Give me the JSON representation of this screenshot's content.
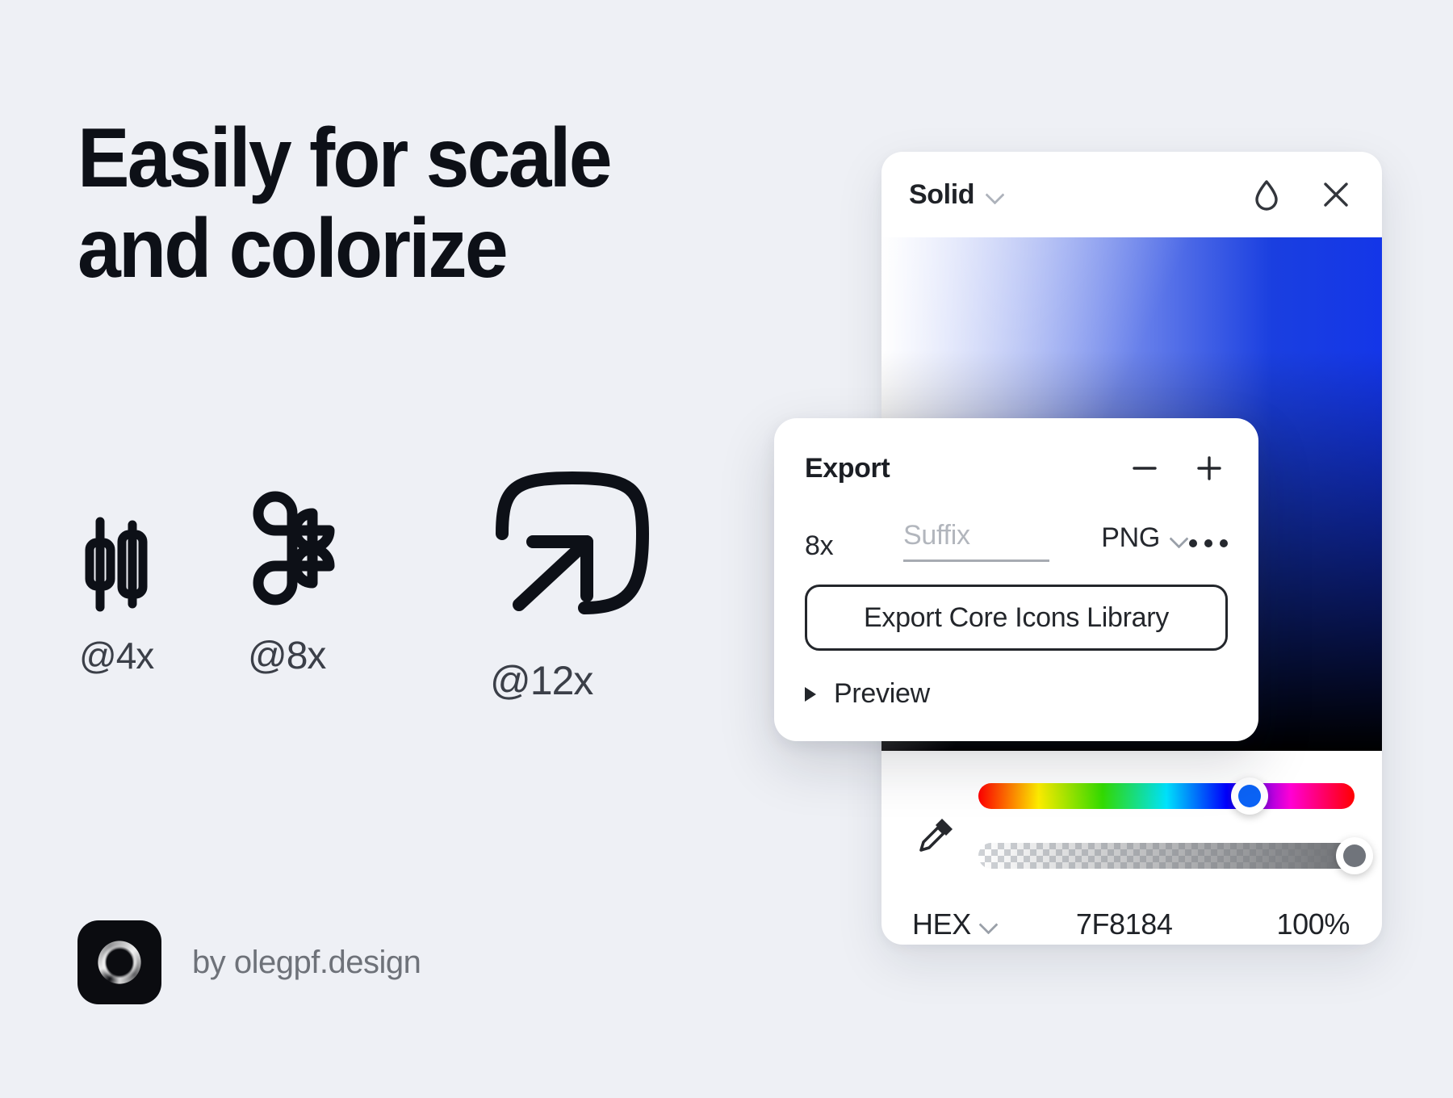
{
  "theme": {
    "background": "#eef0f5",
    "ink": "#0d1017",
    "muted": "#6e7279",
    "accent_blue": "#1a3fe0"
  },
  "headline": {
    "line1": "Easily for scale",
    "line2": "and colorize"
  },
  "showcase": {
    "items": [
      {
        "icon": "candlestick-chart-icon",
        "label": "@4x"
      },
      {
        "icon": "command-key-icon",
        "label": "@8x"
      },
      {
        "icon": "open-external-arrow-icon",
        "label": "@12x"
      }
    ]
  },
  "byline": {
    "logo": "olegpf-vortex-logo",
    "text": "by olegpf.design"
  },
  "color_picker": {
    "mode": "Solid",
    "mode_chevron": "chevron-down-icon",
    "blend_icon": "droplet-icon",
    "close_icon": "close-icon",
    "hue_position_pct": 72,
    "alpha_position_pct": 100,
    "format": "HEX",
    "format_chevron": "chevron-down-icon",
    "hex_value": "7F8184",
    "alpha_value": "100%",
    "eyedropper_icon": "eyedropper-icon",
    "knob_color": "#0b63f6",
    "alpha_knob_color": "#70747b"
  },
  "export_panel": {
    "title": "Export",
    "minus_icon": "minus-icon",
    "plus_icon": "plus-icon",
    "scale": "8x",
    "suffix_placeholder": "Suffix",
    "format": "PNG",
    "format_chevron": "chevron-down-icon",
    "more_icon": "more-horizontal-icon",
    "action_label": "Export Core Icons Library",
    "preview_label": "Preview",
    "preview_triangle": "triangle-right-icon"
  }
}
